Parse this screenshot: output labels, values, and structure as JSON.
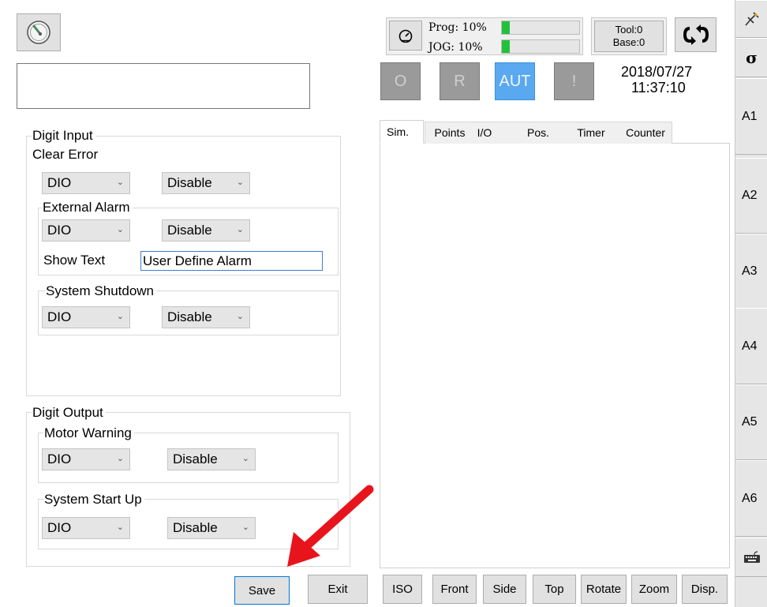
{
  "status": {
    "prog_label": "Prog: 10%",
    "jog_label": "JOG: 10%",
    "prog_percent": 10,
    "jog_percent": 10,
    "tool_label": "Tool:0",
    "base_label": "Base:0",
    "date": "2018/07/27",
    "time": "11:37:10"
  },
  "mode_buttons": {
    "o": "O",
    "r": "R",
    "aut": "AUT",
    "alert": "!"
  },
  "digit_input": {
    "title": "Digit Input",
    "clear_error": {
      "label": "Clear Error",
      "source": "DIO",
      "state": "Disable"
    },
    "external_alarm": {
      "label": "External Alarm",
      "source": "DIO",
      "state": "Disable",
      "show_text_label": "Show Text",
      "show_text_value": "User Define Alarm"
    },
    "system_shutdown": {
      "label": "System Shutdown",
      "source": "DIO",
      "state": "Disable"
    }
  },
  "digit_output": {
    "title": "Digit Output",
    "motor_warning": {
      "label": "Motor Warning",
      "source": "DIO",
      "state": "Disable"
    },
    "system_startup": {
      "label": "System Start Up",
      "source": "DIO",
      "state": "Disable"
    }
  },
  "actions": {
    "save": "Save",
    "exit": "Exit"
  },
  "tabs": [
    "Sim.",
    "Points",
    "I/O",
    "Pos.",
    "Timer",
    "Counter"
  ],
  "view_buttons": [
    "ISO",
    "Front",
    "Side",
    "Top",
    "Rotate",
    "Zoom",
    "Disp."
  ],
  "axes": [
    "A1",
    "A2",
    "A3",
    "A4",
    "A5",
    "A6"
  ],
  "icons": {
    "app": "gauge-logo-icon",
    "speed": "speedometer-icon",
    "sync": "refresh-arrows-icon",
    "pin": "pin-icon",
    "brand": "sigma-logo-icon",
    "keyboard": "keyboard-icon"
  },
  "colors": {
    "aut_active": "#5aa9f0",
    "progress": "#22c13a",
    "arrow": "#e8141c"
  }
}
